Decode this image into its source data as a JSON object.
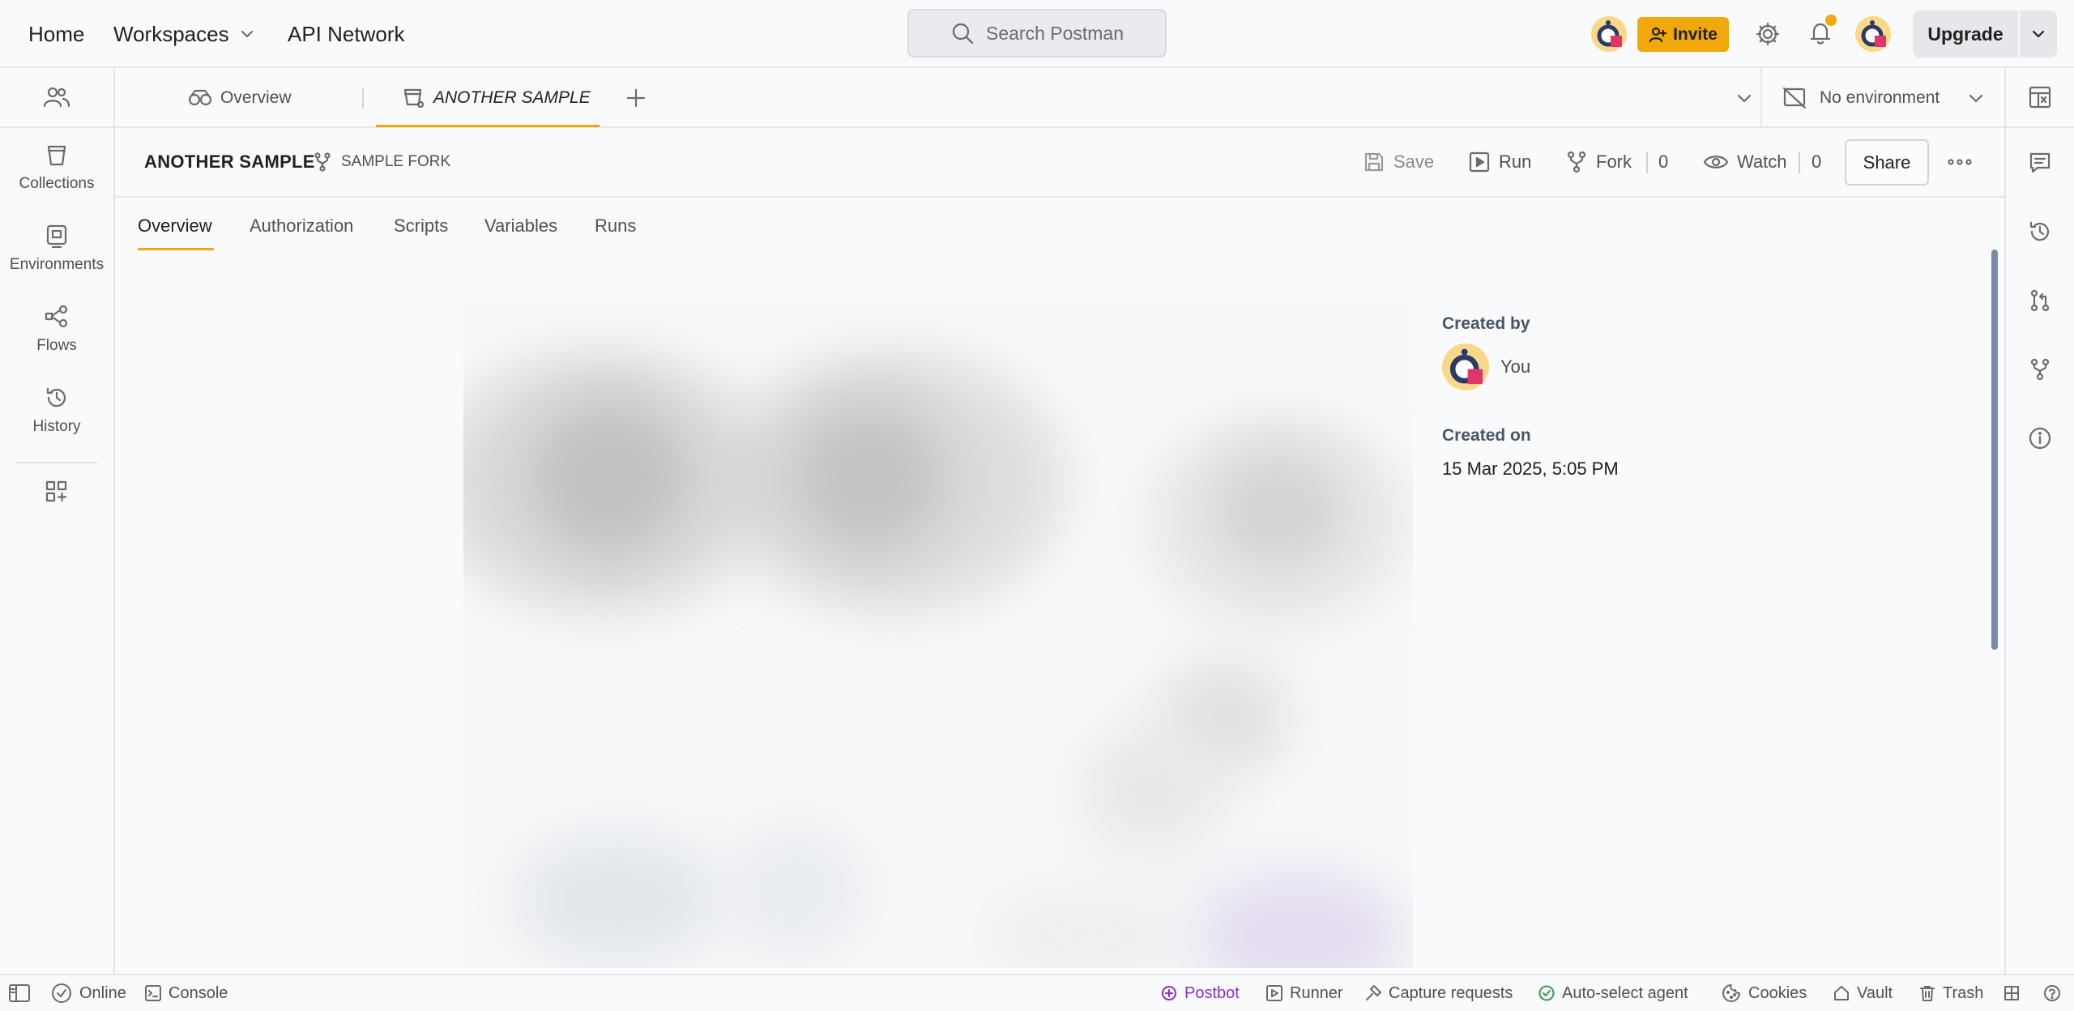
{
  "topbar": {
    "nav": {
      "home": "Home",
      "workspaces": "Workspaces",
      "api_network": "API Network"
    },
    "search_placeholder": "Search Postman",
    "invite_label": "Invite",
    "upgrade_label": "Upgrade"
  },
  "sidebar": {
    "items": [
      {
        "label": "Collections",
        "icon": "collections-icon"
      },
      {
        "label": "Environments",
        "icon": "environments-icon"
      },
      {
        "label": "Flows",
        "icon": "flows-icon"
      },
      {
        "label": "History",
        "icon": "history-icon"
      }
    ]
  },
  "tabs": {
    "overview": "Overview",
    "active": "ANOTHER SAMPLE",
    "environment": "No environment"
  },
  "collection": {
    "title": "ANOTHER SAMPLE",
    "fork_source": "SAMPLE FORK",
    "actions": {
      "save": "Save",
      "run": "Run",
      "fork": "Fork",
      "fork_count": "0",
      "watch": "Watch",
      "watch_count": "0",
      "share": "Share"
    },
    "subtabs": [
      "Overview",
      "Authorization",
      "Scripts",
      "Variables",
      "Runs"
    ],
    "meta": {
      "created_by_label": "Created by",
      "created_by": "You",
      "created_on_label": "Created on",
      "created_on": "15 Mar 2025, 5:05 PM"
    }
  },
  "statusbar": {
    "online": "Online",
    "console": "Console",
    "postbot": "Postbot",
    "runner": "Runner",
    "capture": "Capture requests",
    "agent": "Auto-select agent",
    "cookies": "Cookies",
    "vault": "Vault",
    "trash": "Trash"
  },
  "colors": {
    "accent": "#f0a80a",
    "postbot": "#8a2fc8",
    "notification_dot": "#f0a80a"
  }
}
